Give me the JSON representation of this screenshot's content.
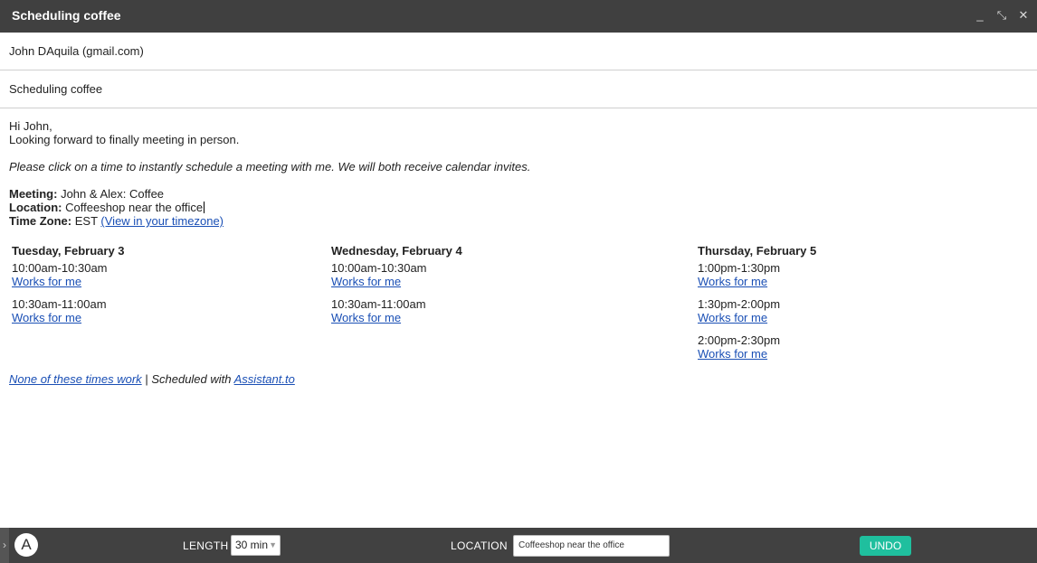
{
  "window": {
    "title": "Scheduling coffee",
    "controls": {
      "minimize": "_",
      "popout": "⤡",
      "close": "✕"
    }
  },
  "to": "John DAquila (gmail.com)",
  "subject": "Scheduling coffee",
  "body": {
    "greeting": "Hi John,",
    "intro": "Looking forward to finally meeting in person.",
    "instructions": "Please click on a time to instantly schedule a meeting with me. We will both receive calendar invites.",
    "meeting_label": "Meeting:",
    "meeting_value": "John & Alex: Coffee",
    "location_label": "Location:",
    "location_value": "Coffeeshop near the office",
    "timezone_label": "Time Zone:",
    "timezone_value": "EST",
    "timezone_link": "(View in your timezone)"
  },
  "days": [
    {
      "header": "Tuesday, February 3",
      "slots": [
        {
          "time": "10:00am-10:30am",
          "link": "Works for me"
        },
        {
          "time": "10:30am-11:00am",
          "link": "Works for me"
        }
      ]
    },
    {
      "header": "Wednesday, February 4",
      "slots": [
        {
          "time": "10:00am-10:30am",
          "link": "Works for me"
        },
        {
          "time": "10:30am-11:00am",
          "link": "Works for me"
        }
      ]
    },
    {
      "header": "Thursday, February 5",
      "slots": [
        {
          "time": "1:00pm-1:30pm",
          "link": "Works for me"
        },
        {
          "time": "1:30pm-2:00pm",
          "link": "Works for me"
        },
        {
          "time": "2:00pm-2:30pm",
          "link": "Works for me"
        }
      ]
    }
  ],
  "footer": {
    "none_work": "None of these times work",
    "separator": "|",
    "scheduled_with": "Scheduled with",
    "assistant_link": "Assistant.to"
  },
  "toolbar": {
    "logo": "A",
    "handle": "›",
    "length_label": "LENGTH",
    "length_value": "30 min",
    "location_label": "LOCATION",
    "location_value": "Coffeeshop near the office",
    "undo_label": "UNDO",
    "undo_color": "#1fbf9e"
  }
}
